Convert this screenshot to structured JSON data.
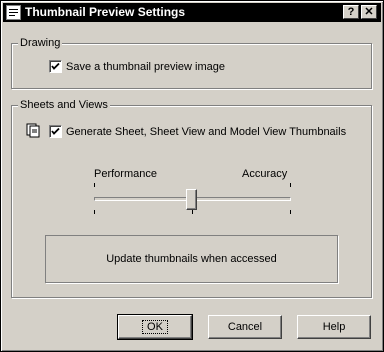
{
  "window": {
    "title": "Thumbnail Preview Settings",
    "help_button": "?",
    "close_button": "✕"
  },
  "drawing": {
    "legend": "Drawing",
    "save_thumbnail": {
      "label": "Save a thumbnail preview image",
      "checked": true
    }
  },
  "sheets": {
    "legend": "Sheets and Views",
    "generate_thumbnails": {
      "label": "Generate Sheet, Sheet View and Model View Thumbnails",
      "checked": true
    },
    "slider": {
      "left_label": "Performance",
      "right_label": "Accuracy",
      "value_fraction": 0.48
    },
    "status_text": "Update thumbnails when accessed"
  },
  "buttons": {
    "ok": "OK",
    "cancel": "Cancel",
    "help": "Help"
  },
  "colors": {
    "dialog_bg": "#d4d0c8",
    "title_bg": "#000000",
    "title_fg": "#ffffff"
  },
  "icons": {
    "app": "autocad-app-icon",
    "sheets": "sheet-set-icon",
    "check": "checkmark-icon"
  }
}
